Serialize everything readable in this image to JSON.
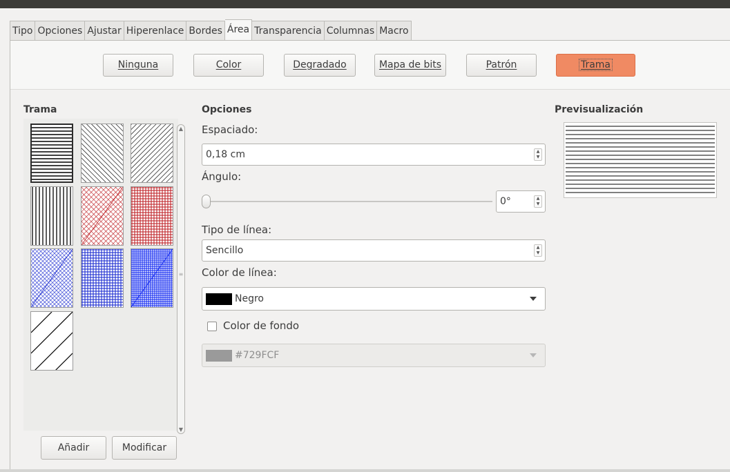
{
  "tabs": [
    "Tipo",
    "Opciones",
    "Ajustar",
    "Hiperenlace",
    "Bordes",
    "Área",
    "Transparencia",
    "Columnas",
    "Macro"
  ],
  "active_tab": "Área",
  "fill_buttons": {
    "none": "Ninguna",
    "color": "Color",
    "gradient": "Degradado",
    "bitmap": "Mapa de bits",
    "pattern": "Patrón",
    "hatch": "Trama"
  },
  "selected_fill": "Trama",
  "hatch_panel": {
    "heading": "Trama",
    "add_button": "Añadir",
    "modify_button": "Modificar"
  },
  "options": {
    "heading": "Opciones",
    "spacing_label": "Espaciado:",
    "spacing_value": "0,18 cm",
    "angle_label": "Ángulo:",
    "angle_value": "0°",
    "angle_slider_fraction": 0,
    "line_type_label": "Tipo de línea:",
    "line_type_value": "Sencillo",
    "line_color_label": "Color de línea:",
    "line_color_value": "Negro",
    "line_color_hex": "#000000",
    "background_color_label": "Color de fondo",
    "background_color_checked": false,
    "background_color_value": "#729FCF",
    "background_color_swatch": "#9a9a9a"
  },
  "preview": {
    "heading": "Previsualización"
  },
  "colors": {
    "accent_selected": "#f08a63",
    "red_hatch": "#c0262b",
    "blue_hatch": "#1f2fd0"
  }
}
